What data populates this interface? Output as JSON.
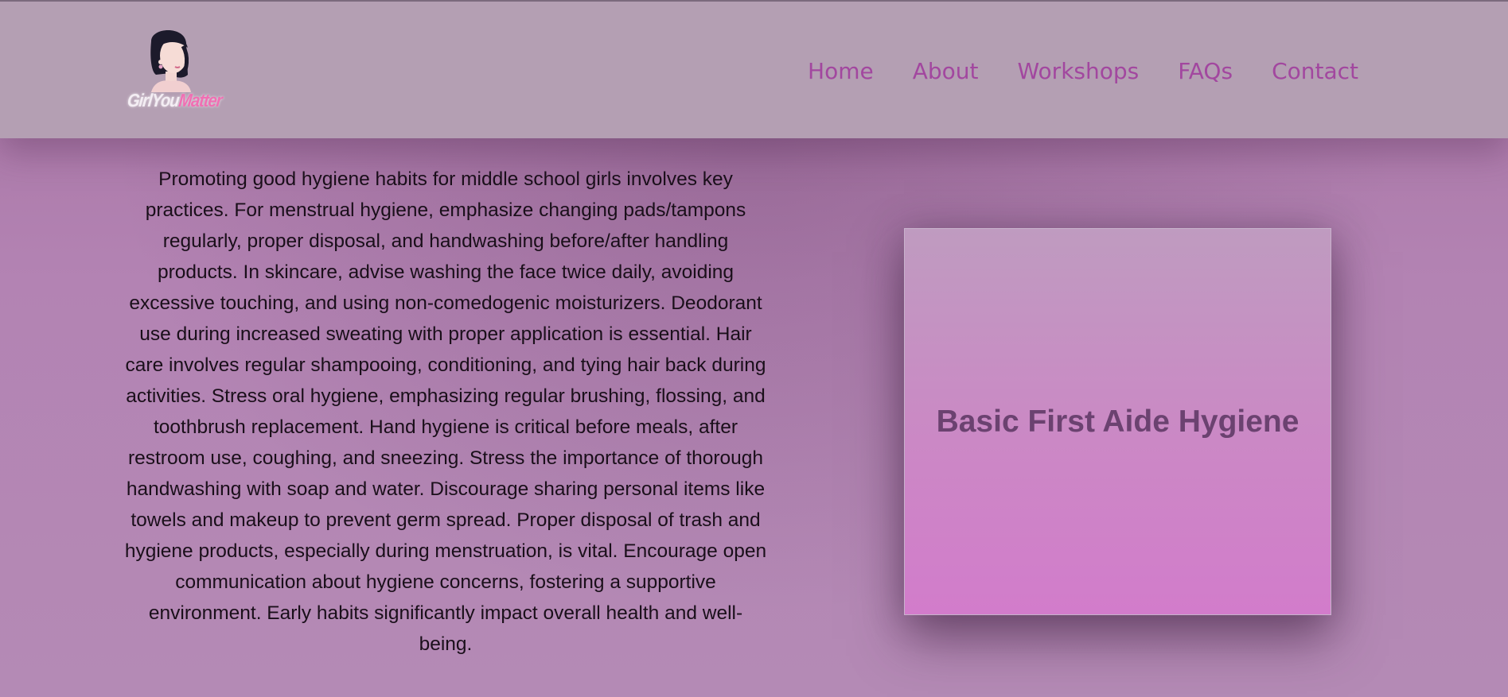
{
  "header": {
    "logo": {
      "text_part1": "GirlYou",
      "text_part2": "Matter"
    },
    "nav": [
      {
        "label": "Home"
      },
      {
        "label": "About"
      },
      {
        "label": "Workshops"
      },
      {
        "label": "FAQs"
      },
      {
        "label": "Contact"
      }
    ]
  },
  "main": {
    "body_text": "Promoting good hygiene habits for middle school girls involves key practices. For menstrual hygiene, emphasize changing pads/tampons regularly, proper disposal, and handwashing before/after handling products. In skincare, advise washing the face twice daily, avoiding excessive touching, and using non-comedogenic moisturizers. Deodorant use during increased sweating with proper application is essential. Hair care involves regular shampooing, conditioning, and tying hair back during activities. Stress oral hygiene, emphasizing regular brushing, flossing, and toothbrush replacement. Hand hygiene is critical before meals, after restroom use, coughing, and sneezing. Stress the importance of thorough handwashing with soap and water. Discourage sharing personal items like towels and makeup to prevent germ spread. Proper disposal of trash and hygiene products, especially during menstruation, is vital. Encourage open communication about hygiene concerns, fostering a supportive environment. Early habits significantly impact overall health and well-being.",
    "card_title": "Basic First Aide Hygiene"
  },
  "colors": {
    "header_bg": "#b49fb3",
    "nav_link": "#a2479f",
    "page_bg": "#b383b3",
    "card_title": "#6b4270"
  }
}
